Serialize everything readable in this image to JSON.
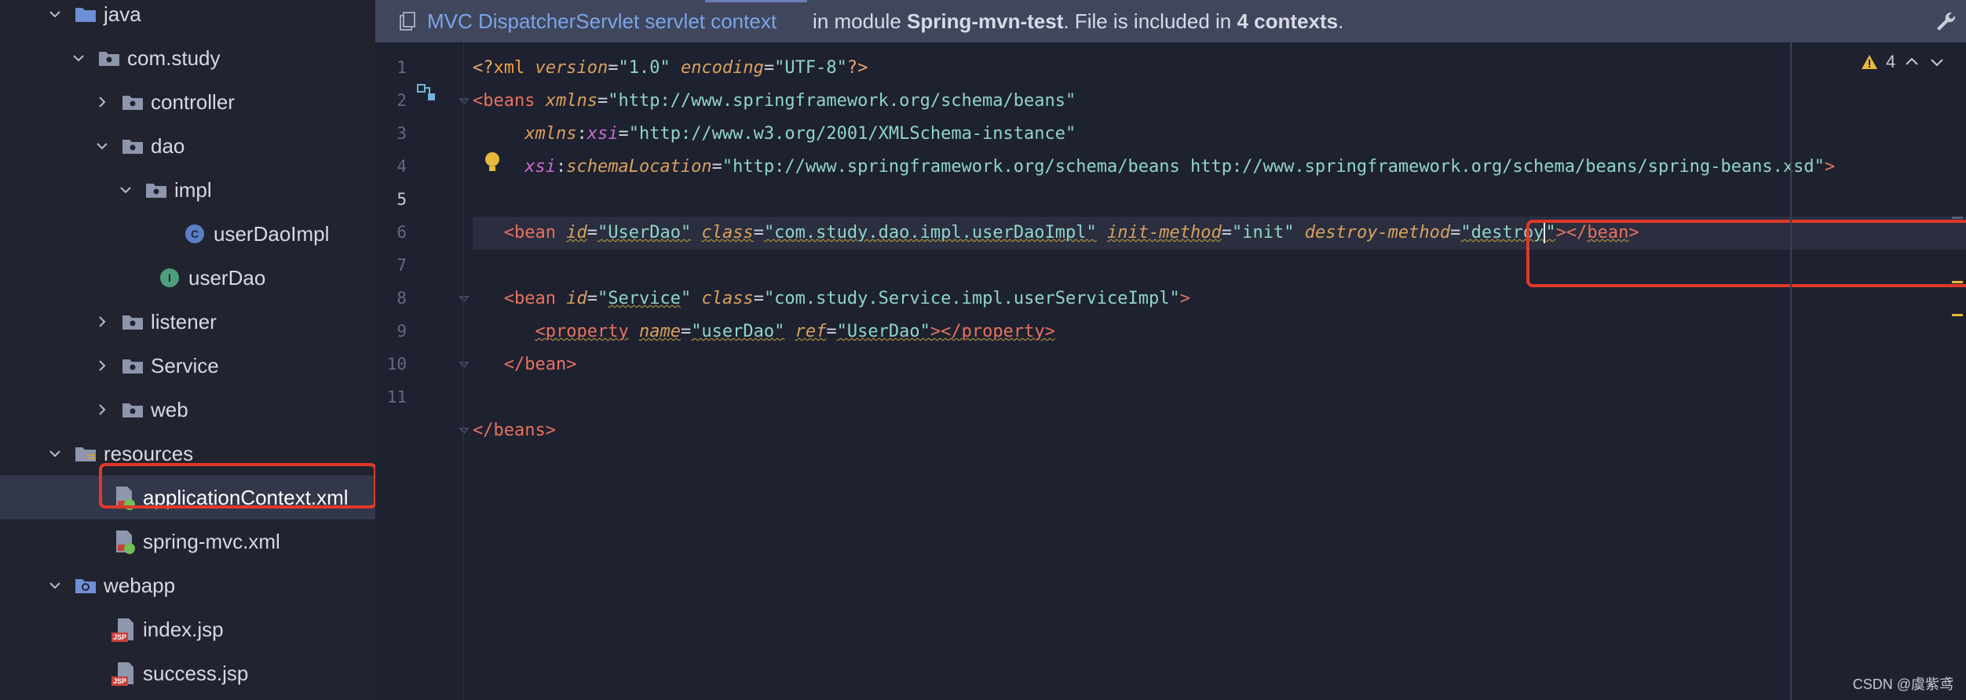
{
  "tree": {
    "items": [
      {
        "label": "java",
        "kind": "folder-src",
        "chevron": "down"
      },
      {
        "label": "com.study",
        "kind": "package",
        "chevron": "down"
      },
      {
        "label": "controller",
        "kind": "package",
        "chevron": "right"
      },
      {
        "label": "dao",
        "kind": "package",
        "chevron": "down"
      },
      {
        "label": "impl",
        "kind": "package",
        "chevron": "down"
      },
      {
        "label": "userDaoImpl",
        "kind": "class",
        "badge": "C"
      },
      {
        "label": "userDao",
        "kind": "interface",
        "badge": "I"
      },
      {
        "label": "listener",
        "kind": "package",
        "chevron": "right"
      },
      {
        "label": "Service",
        "kind": "package",
        "chevron": "right"
      },
      {
        "label": "web",
        "kind": "package",
        "chevron": "right"
      },
      {
        "label": "resources",
        "kind": "folder-res",
        "chevron": "down"
      },
      {
        "label": "applicationContext.xml",
        "kind": "xml",
        "selected": true
      },
      {
        "label": "spring-mvc.xml",
        "kind": "xml"
      },
      {
        "label": "webapp",
        "kind": "folder-web",
        "chevron": "down"
      },
      {
        "label": "index.jsp",
        "kind": "jsp",
        "tag": "JSP"
      },
      {
        "label": "success.jsp",
        "kind": "jsp",
        "tag": "JSP"
      }
    ]
  },
  "banner": {
    "context_link": "MVC DispatcherServlet servlet context",
    "text_prefix": "in module ",
    "module": "Spring-mvn-test",
    "text_mid": ". File is included in ",
    "contexts": "4 contexts",
    "text_end": "."
  },
  "inspection": {
    "warning_count": "4"
  },
  "editor": {
    "line_numbers": [
      "1",
      "2",
      "3",
      "4",
      "5",
      "6",
      "7",
      "8",
      "9",
      "10",
      "11"
    ],
    "active_line": "5"
  },
  "watermark": "CSDN @虞紫鸢",
  "colors": {
    "highlight_box": "#e0382a",
    "accent_link": "#7aa5e8"
  }
}
